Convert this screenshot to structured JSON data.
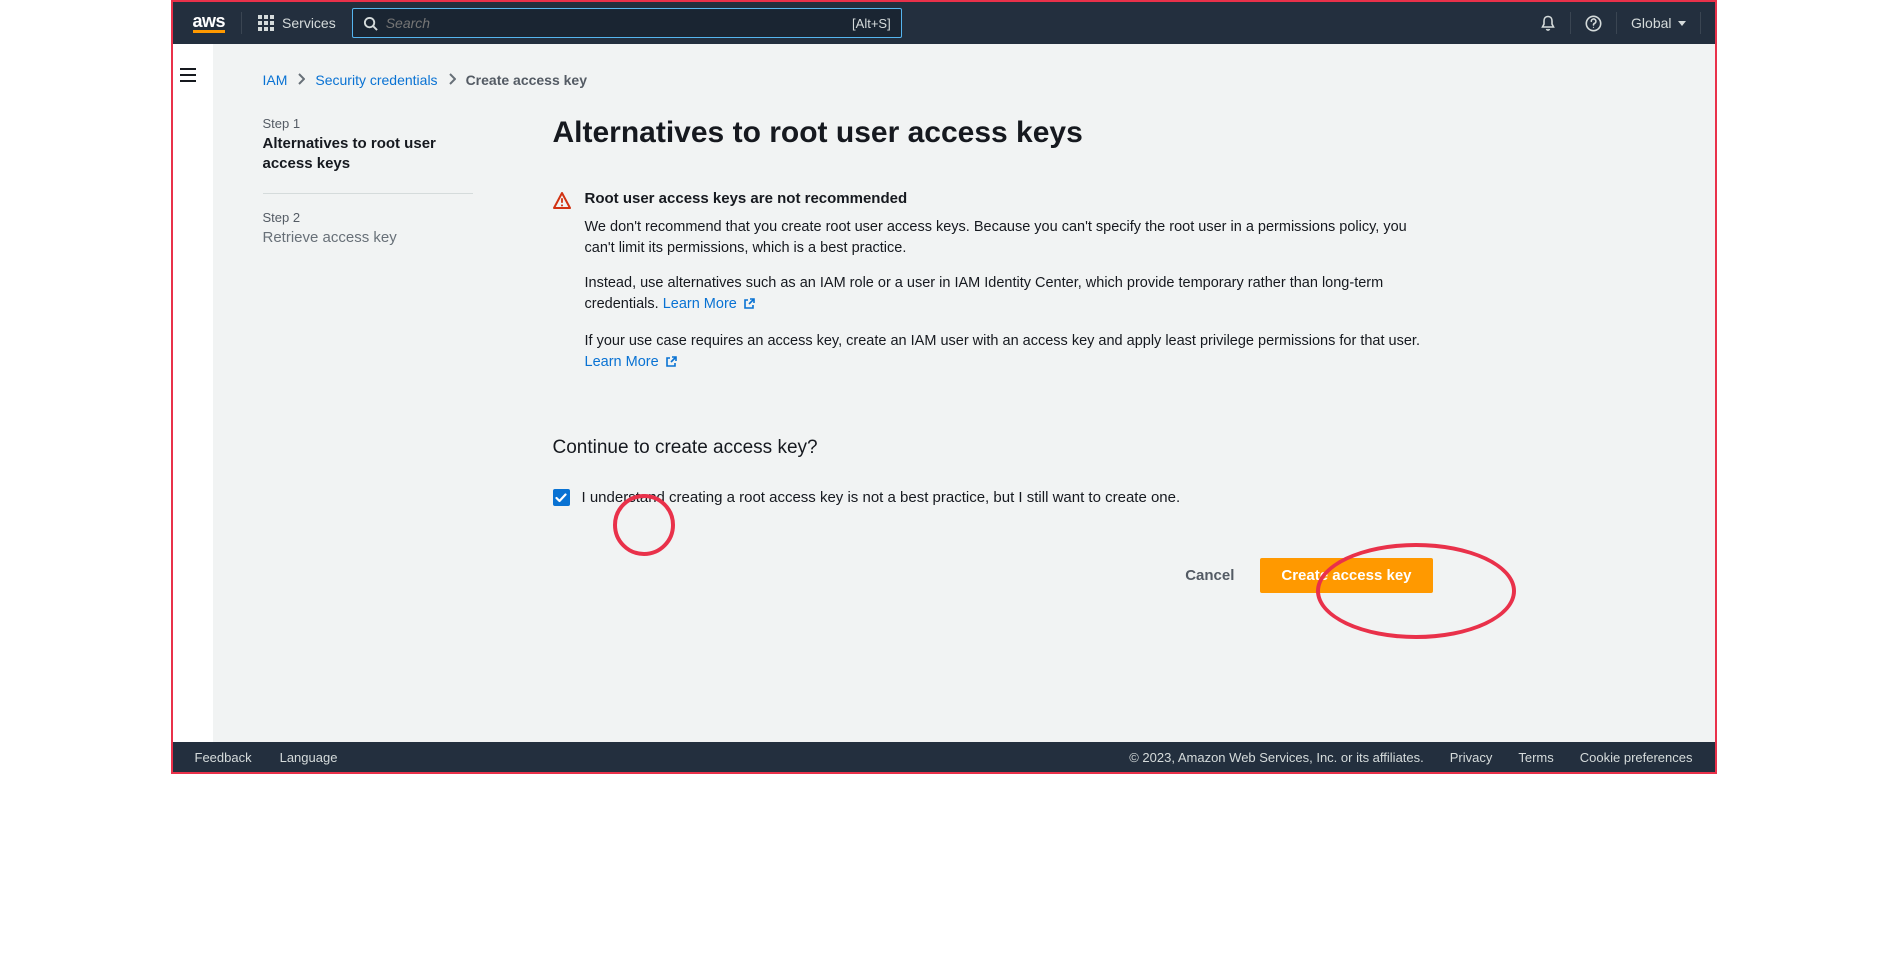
{
  "topnav": {
    "services_label": "Services",
    "search_placeholder": "Search",
    "search_shortcut": "[Alt+S]",
    "region": "Global"
  },
  "breadcrumbs": {
    "root": "IAM",
    "parent": "Security credentials",
    "current": "Create access key"
  },
  "steps": [
    {
      "num": "Step 1",
      "title": "Alternatives to root user access keys"
    },
    {
      "num": "Step 2",
      "title": "Retrieve access key"
    }
  ],
  "main": {
    "title": "Alternatives to root user access keys",
    "alert_title": "Root user access keys are not recommended",
    "p1": "We don't recommend that you create root user access keys. Because you can't specify the root user in a permissions policy, you can't limit its permissions, which is a best practice.",
    "p2a": "Instead, use alternatives such as an IAM role or a user in IAM Identity Center, which provide temporary rather than long-term credentials. ",
    "p2_link": "Learn More",
    "p3a": "If your use case requires an access key, create an IAM user with an access key and apply least privilege permissions for that user. ",
    "p3_link": "Learn More",
    "confirm_heading": "Continue to create access key?",
    "checkbox_label": "I understand creating a root access key is not a best practice, but I still want to create one.",
    "cancel": "Cancel",
    "create": "Create access key"
  },
  "footer": {
    "feedback": "Feedback",
    "language": "Language",
    "copyright": "© 2023, Amazon Web Services, Inc. or its affiliates.",
    "privacy": "Privacy",
    "terms": "Terms",
    "cookies": "Cookie preferences"
  }
}
